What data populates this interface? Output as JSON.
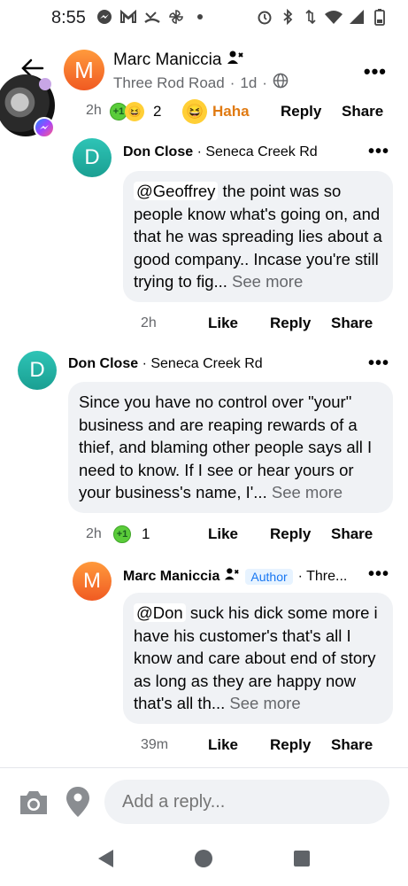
{
  "status_bar": {
    "time": "8:55",
    "left_icons": [
      "messenger-icon",
      "gmail-icon",
      "missed-call-icon",
      "pinwheel-icon",
      "dot-icon"
    ],
    "right_icons": [
      "alarm-icon",
      "bluetooth-icon",
      "data-arrows-icon",
      "wifi-icon",
      "signal-icon",
      "battery-icon"
    ]
  },
  "header": {
    "avatar_letter": "M",
    "name": "Marc Maniccia",
    "location": "Three Rod Road",
    "age": "1d",
    "separator": "·"
  },
  "top_action_row": {
    "time": "2h",
    "reaction_count": "2",
    "haha_label": "Haha",
    "reply_label": "Reply",
    "share_label": "Share"
  },
  "comments": [
    {
      "avatar_letter": "D",
      "name": "Don Close",
      "location": "· Seneca Creek Rd",
      "mention": "@Geoffrey",
      "body": " the point was so people know what's going on, and that he was spreading lies about a good company.. Incase you're still trying to fig...",
      "see_more": " See more",
      "time": "2h",
      "like_label": "Like",
      "reply_label": "Reply",
      "share_label": "Share"
    },
    {
      "avatar_letter": "D",
      "name": "Don Close",
      "location": "· Seneca Creek Rd",
      "body": "Since you have no control over \"your\" business and are reaping rewards of a thief, and blaming other people says all I need to know. If I see or hear yours or your business's name, I'...",
      "see_more": " See more",
      "time": "2h",
      "reaction_count": "1",
      "like_label": "Like",
      "reply_label": "Reply",
      "share_label": "Share"
    },
    {
      "avatar_letter": "M",
      "name": "Marc Maniccia",
      "author_tag": "Author",
      "location": "· Thre...",
      "mention": "@Don",
      "body": " suck his dick some more i have his customer's that's all I know and care about  end of story as long as they are happy now that's all th...",
      "see_more": " See more",
      "time": "39m",
      "like_label": "Like",
      "reply_label": "Reply",
      "share_label": "Share"
    }
  ],
  "composer": {
    "placeholder": "Add a reply..."
  },
  "colors": {
    "accent_blue": "#1877f2",
    "haha_orange": "#e07a12",
    "bubble_gray": "#f0f2f5",
    "secondary_text": "#65676b"
  }
}
